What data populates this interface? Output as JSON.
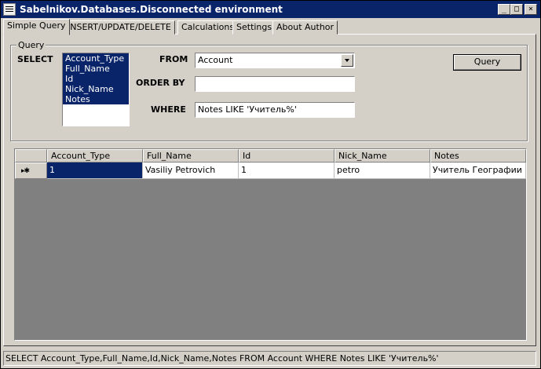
{
  "window": {
    "title": "Sabelnikov.Databases.Disconnected environment",
    "buttons": {
      "minimize": "_",
      "maximize": "□",
      "close": "×"
    }
  },
  "tabs": [
    {
      "label": "Simple Query",
      "active": true
    },
    {
      "label": "INSERT/UPDATE/DELETE",
      "active": false
    },
    {
      "label": "Calculations",
      "active": false
    },
    {
      "label": "Settings",
      "active": false
    },
    {
      "label": "About Author",
      "active": false
    }
  ],
  "query": {
    "group_label": "Query",
    "select_label": "SELECT",
    "select_items": [
      "Account_Type",
      "Full_Name",
      "Id",
      "Nick_Name",
      "Notes"
    ],
    "from_label": "FROM",
    "from_value": "Account",
    "orderby_label": "ORDER BY",
    "orderby_value": "",
    "where_label": "WHERE",
    "where_value": "Notes LIKE 'Учитель%'",
    "query_button": "Query"
  },
  "grid": {
    "columns": [
      "Account_Type",
      "Full_Name",
      "Id",
      "Nick_Name",
      "Notes"
    ],
    "row_marker": "▸✱",
    "rows": [
      [
        "1",
        "Vasiliy Petrovich",
        "1",
        "petro",
        "Учитель Географии"
      ]
    ]
  },
  "status": {
    "text": "SELECT Account_Type,Full_Name,Id,Nick_Name,Notes FROM Account WHERE Notes LIKE 'Учитель%'"
  },
  "colors": {
    "selection": "#0a246a",
    "face": "#d4d0c8",
    "grid_background": "#808080"
  }
}
